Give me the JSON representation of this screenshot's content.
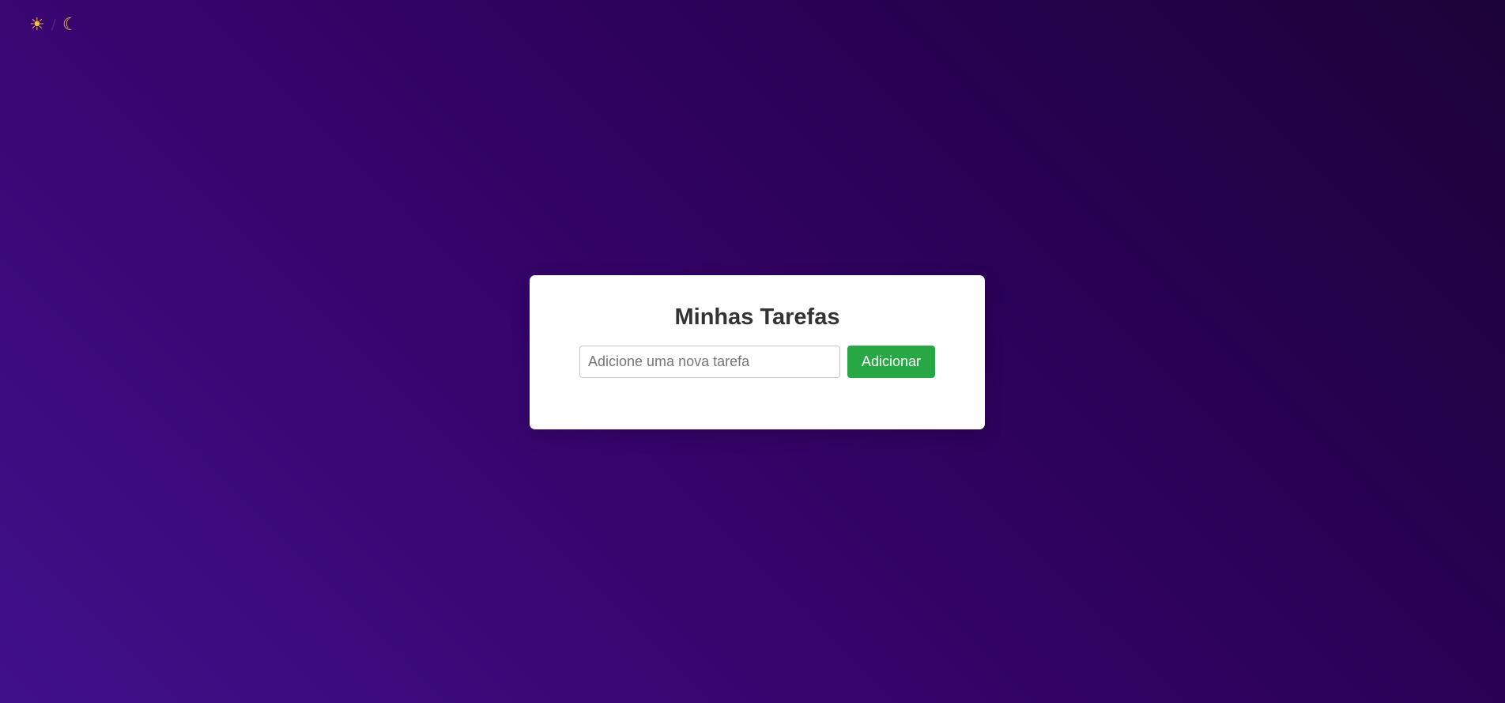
{
  "theme_toggle": {
    "light_icon": "☀",
    "separator": "/",
    "dark_icon": "☾"
  },
  "todo": {
    "title": "Minhas Tarefas",
    "input": {
      "placeholder": "Adicione uma nova tarefa",
      "value": ""
    },
    "add_button_label": "Adicionar"
  },
  "colors": {
    "background_dark": "#1c0338",
    "background_purple": "#38056f",
    "card": "#ffffff",
    "button": "#28a745",
    "title": "#333333",
    "icons": "#f6c23e"
  }
}
